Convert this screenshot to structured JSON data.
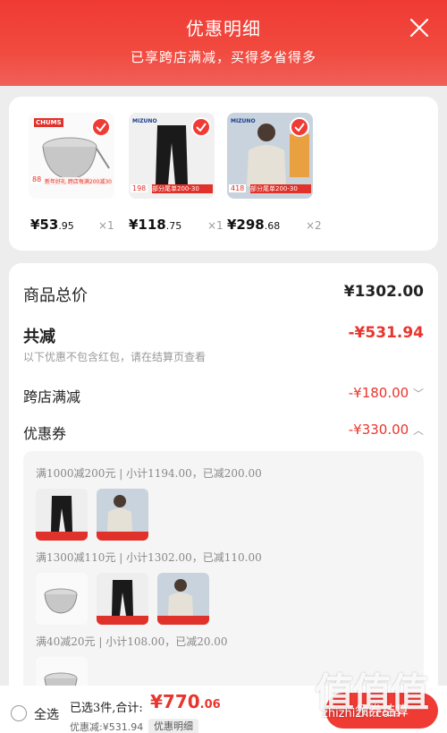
{
  "header": {
    "title": "优惠明细",
    "subtitle": "已享跨店满减，买得多省得多"
  },
  "products": [
    {
      "brand": "CHUMS",
      "price_main": "¥53",
      "price_dec": ".95",
      "qty": "×1",
      "badge": "88",
      "tag": "新年好礼 跨店每满200减30"
    },
    {
      "brand": "MIZUNO",
      "price_main": "¥118",
      "price_dec": ".75",
      "qty": "×1",
      "badge": "198",
      "tag": "部分尾单200-30"
    },
    {
      "brand": "MIZUNO",
      "price_main": "¥298",
      "price_dec": ".68",
      "qty": "×2",
      "badge": "418",
      "tag": "部分尾单200-30"
    }
  ],
  "summary": {
    "total_label": "商品总价",
    "total_value": "¥1302.00",
    "discount_label": "共减",
    "discount_value": "-¥531.94",
    "note": "以下优惠不包含红包，请在结算页查看",
    "cross_store_label": "跨店满减",
    "cross_store_value": "-¥180.00",
    "coupon_label": "优惠券",
    "coupon_value": "-¥330.00"
  },
  "coupons": [
    {
      "text": "满1000减200元 | 小计1194.00，已减200.00"
    },
    {
      "text": "满1300减110元 | 小计1302.00，已减110.00"
    },
    {
      "text": "满40减20元 | 小计108.00，已减20.00"
    }
  ],
  "bottom": {
    "select_all": "全选",
    "selected_text": "已选3件,合计:",
    "total_main": "¥770",
    "total_dec": ".06",
    "discount_text": "优惠减:¥531.94",
    "detail_button": "优惠明细",
    "settle_button": "领券结算"
  },
  "watermark": {
    "big": "值值值",
    "small": "zhizhizhi.com"
  },
  "colors": {
    "accent": "#f03a34",
    "discount": "#e8352d"
  }
}
